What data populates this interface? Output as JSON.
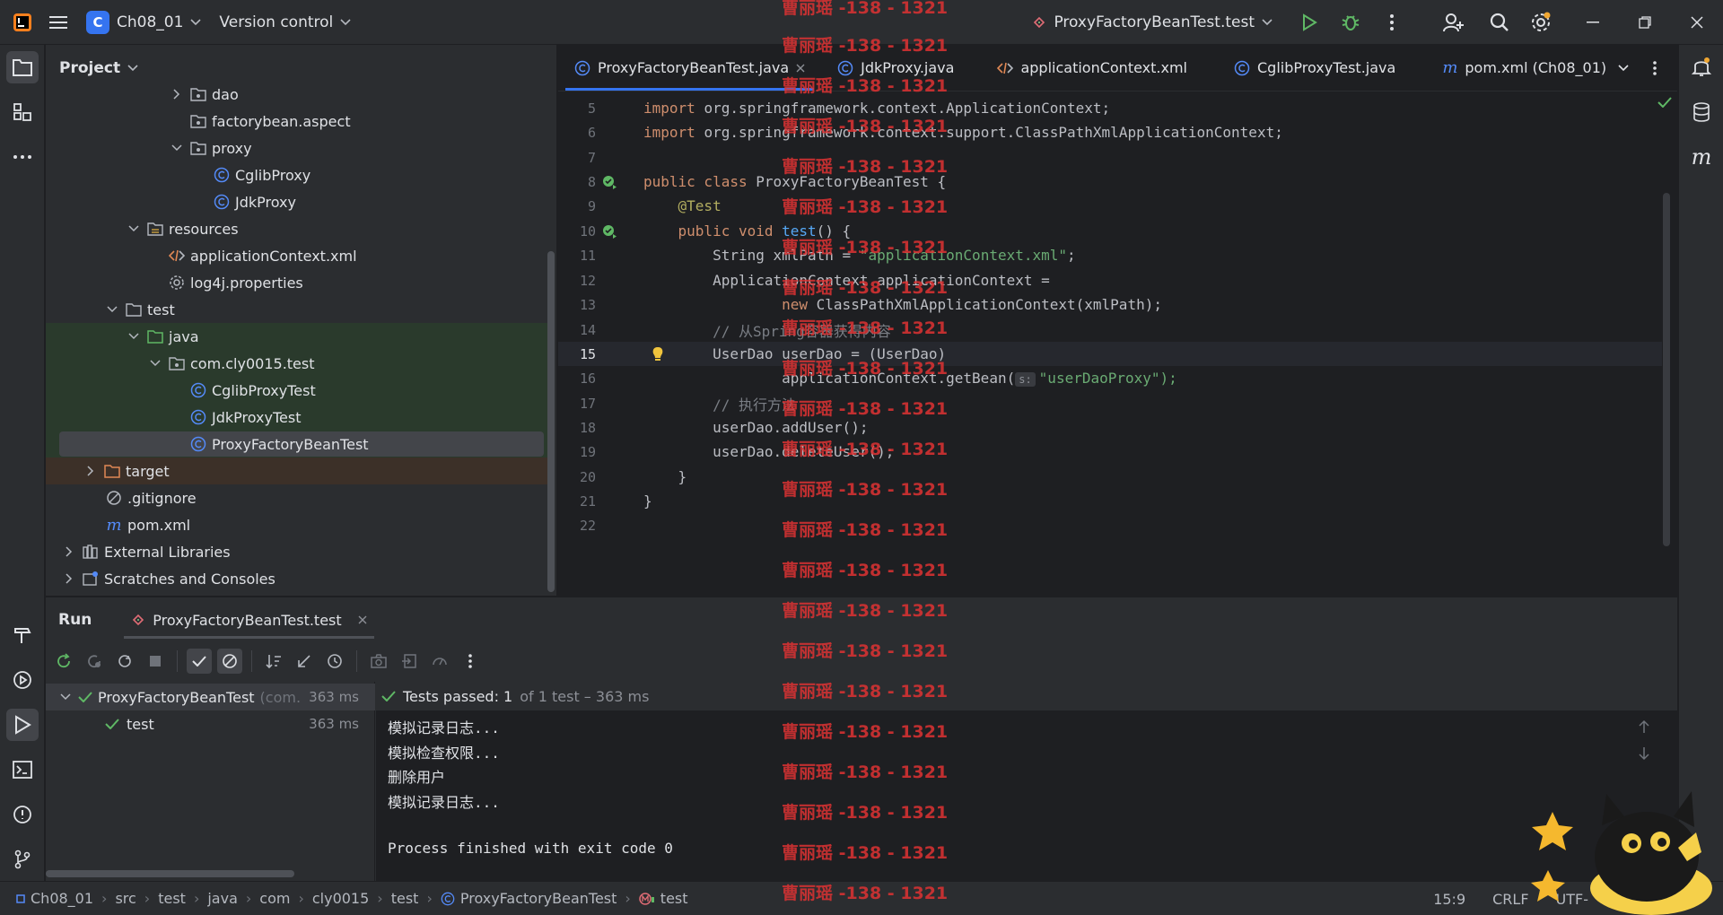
{
  "titlebar": {
    "project_badge": "C",
    "project_name": "Ch08_01",
    "vcs_label": "Version control",
    "run_config": "ProxyFactoryBeanTest.test"
  },
  "project_panel": {
    "title": "Project",
    "items": [
      {
        "label": "dao",
        "icon": "package-folder-icon"
      },
      {
        "label": "factorybean.aspect",
        "icon": "package-folder-icon"
      },
      {
        "label": "proxy",
        "icon": "package-folder-icon"
      },
      {
        "label": "CglibProxy",
        "icon": "java-class-icon"
      },
      {
        "label": "JdkProxy",
        "icon": "java-class-icon"
      },
      {
        "label": "resources",
        "icon": "resources-folder-icon"
      },
      {
        "label": "applicationContext.xml",
        "icon": "xml-file-icon"
      },
      {
        "label": "log4j.properties",
        "icon": "properties-file-icon"
      },
      {
        "label": "test",
        "icon": "folder-icon"
      },
      {
        "label": "java",
        "icon": "test-source-folder-icon"
      },
      {
        "label": "com.cly0015.test",
        "icon": "package-folder-icon"
      },
      {
        "label": "CglibProxyTest",
        "icon": "java-class-icon"
      },
      {
        "label": "JdkProxyTest",
        "icon": "java-class-icon"
      },
      {
        "label": "ProxyFactoryBeanTest",
        "icon": "java-class-icon"
      },
      {
        "label": "target",
        "icon": "excluded-folder-icon"
      },
      {
        "label": ".gitignore",
        "icon": "ignore-file-icon"
      },
      {
        "label": "pom.xml",
        "icon": "maven-icon"
      },
      {
        "label": "External Libraries",
        "icon": "library-icon"
      },
      {
        "label": "Scratches and Consoles",
        "icon": "scratches-icon"
      }
    ]
  },
  "editor": {
    "tabs": [
      {
        "label": "ProxyFactoryBeanTest.java",
        "icon": "java-class-icon",
        "active": true
      },
      {
        "label": "JdkProxy.java",
        "icon": "java-class-icon"
      },
      {
        "label": "applicationContext.xml",
        "icon": "xml-file-icon"
      },
      {
        "label": "CglibProxyTest.java",
        "icon": "java-class-icon"
      },
      {
        "label": "pom.xml (Ch08_01)",
        "icon": "maven-icon"
      }
    ],
    "lines": [
      {
        "n": "5",
        "code": "import org.springframework.context.ApplicationContext;"
      },
      {
        "n": "6",
        "code": "import org.springframework.context.support.ClassPathXmlApplicationContext;"
      },
      {
        "n": "7",
        "code": ""
      },
      {
        "n": "8",
        "code": "public class ProxyFactoryBeanTest {"
      },
      {
        "n": "9",
        "code": "    @Test"
      },
      {
        "n": "10",
        "code": "    public void test() {"
      },
      {
        "n": "11",
        "code": "        String xmlPath = \"applicationContext.xml\";"
      },
      {
        "n": "12",
        "code": "        ApplicationContext applicationContext ="
      },
      {
        "n": "13",
        "code": "                new ClassPathXmlApplicationContext(xmlPath);"
      },
      {
        "n": "14",
        "code": "        // 从Spring容器获得内容"
      },
      {
        "n": "15",
        "code": "        UserDao userDao = (UserDao)"
      },
      {
        "n": "16",
        "code_pre": "                applicationContext.getBean(",
        "hint": "s:",
        "code_post": "\"userDaoProxy\");"
      },
      {
        "n": "17",
        "code": "        // 执行方法"
      },
      {
        "n": "18",
        "code": "        userDao.addUser();"
      },
      {
        "n": "19",
        "code": "        userDao.deleteUser();"
      },
      {
        "n": "20",
        "code": "    }"
      },
      {
        "n": "21",
        "code": "}"
      },
      {
        "n": "22",
        "code": ""
      }
    ]
  },
  "run_panel": {
    "title": "Run",
    "tab_label": "ProxyFactoryBeanTest.test",
    "tree": [
      {
        "label": "ProxyFactoryBeanTest",
        "suffix": "(com.c",
        "time": "363 ms"
      },
      {
        "label": "test",
        "time": "363 ms"
      }
    ],
    "status_bold": "Tests passed: 1",
    "status_rest": "of 1 test – 363 ms",
    "console": [
      "模拟记录日志...",
      "模拟检查权限...",
      "删除用户",
      "模拟记录日志...",
      "",
      "Process finished with exit code 0"
    ]
  },
  "statusbar": {
    "crumbs": [
      "Ch08_01",
      "src",
      "test",
      "java",
      "com",
      "cly0015",
      "test",
      "ProxyFactoryBeanTest",
      "test"
    ],
    "position": "15:9",
    "line_sep": "CRLF",
    "encoding": "UTF-"
  },
  "watermark": {
    "text": "曹丽瑶 -138 - 1321"
  },
  "colors": {
    "accent": "#3574f0",
    "success": "#5fb865",
    "watermark": "#de3232"
  }
}
